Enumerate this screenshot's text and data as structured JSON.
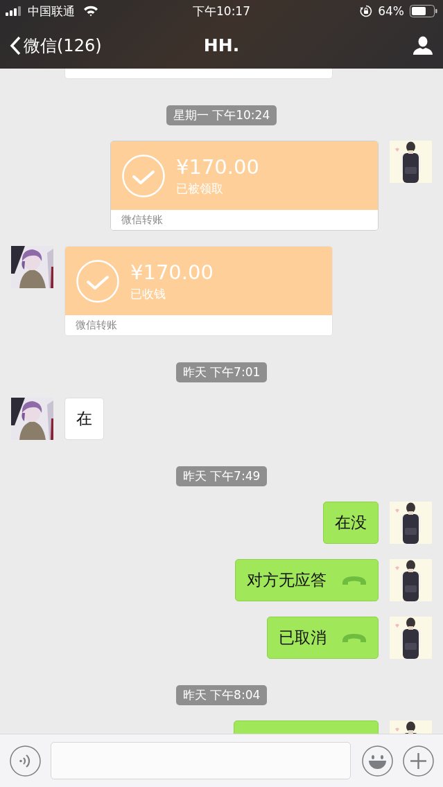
{
  "status_bar": {
    "carrier": "中国联通",
    "time": "下午10:17",
    "battery": "64%"
  },
  "nav": {
    "back_label": "微信(126)",
    "title": "HH."
  },
  "messages": [
    {
      "kind": "transfer_cut",
      "outgoing": false
    },
    {
      "kind": "time",
      "text": "星期一 下午10:24"
    },
    {
      "kind": "transfer",
      "outgoing": true,
      "amount": "¥170.00",
      "status": "已被领取",
      "footer": "微信转账"
    },
    {
      "kind": "transfer",
      "outgoing": false,
      "amount": "¥170.00",
      "status": "已收钱",
      "footer": "微信转账"
    },
    {
      "kind": "time",
      "text": "昨天 下午7:01"
    },
    {
      "kind": "text",
      "outgoing": false,
      "text": "在"
    },
    {
      "kind": "time",
      "text": "昨天 下午7:49"
    },
    {
      "kind": "text",
      "outgoing": true,
      "text": "在没"
    },
    {
      "kind": "call",
      "outgoing": true,
      "text": "对方无应答"
    },
    {
      "kind": "call",
      "outgoing": true,
      "text": "已取消"
    },
    {
      "kind": "time",
      "text": "昨天 下午8:04"
    },
    {
      "kind": "cut",
      "outgoing": true
    }
  ]
}
